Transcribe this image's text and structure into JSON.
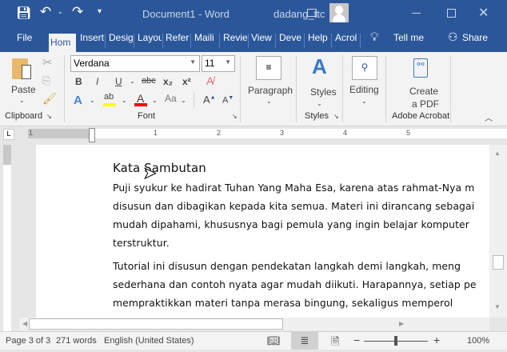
{
  "title_bar": {
    "document_title": "Document1  -  Word",
    "user": "dadang_ttc"
  },
  "tabs": [
    "File",
    "Hom",
    "Insert",
    "Desig",
    "Layou",
    "Refer",
    "Maili",
    "Revie",
    "View",
    "Deve",
    "Help",
    "Acrol"
  ],
  "tell_me": "Tell me",
  "share": "Share",
  "ribbon": {
    "clipboard": {
      "paste": "Paste",
      "label": "Clipboard"
    },
    "font": {
      "name": "Verdana",
      "size": "11",
      "label": "Font",
      "bold": "B",
      "italic": "I",
      "underline": "U",
      "strike": "abc",
      "sub": "x₂",
      "sup": "x²",
      "case": "Aa"
    },
    "paragraph": {
      "label": "Paragraph"
    },
    "styles": {
      "label": "Styles",
      "group": "Styles"
    },
    "editing": {
      "label": "Editing"
    },
    "acrobat": {
      "create": "Create",
      "pdf": "a PDF",
      "label": "Adobe Acrobat"
    }
  },
  "ruler": [
    "1",
    "1",
    "2",
    "3",
    "4",
    "5"
  ],
  "document": {
    "heading": "Kata Sambutan",
    "lines": [
      "Puji syukur ke hadirat Tuhan Yang Maha Esa, karena atas rahmat-Nya m",
      "disusun dan dibagikan kepada kita semua. Materi ini dirancang sebagai",
      "mudah dipahami, khususnya bagi pemula yang ingin belajar komputer",
      "terstruktur.",
      "Tutorial ini disusun dengan pendekatan langkah demi langkah, meng",
      "sederhana dan contoh nyata agar mudah diikuti. Harapannya, setiap pe",
      "mempraktikkan materi tanpa merasa bingung, sekaligus memperol"
    ]
  },
  "status": {
    "page": "Page 3 of 3",
    "words": "271 words",
    "language": "English (United States)",
    "zoom": "100%",
    "zoom_percent": 100
  },
  "colors": {
    "accent": "#2b579a",
    "highlight": "#ffff00",
    "font_color": "#ff0000"
  }
}
